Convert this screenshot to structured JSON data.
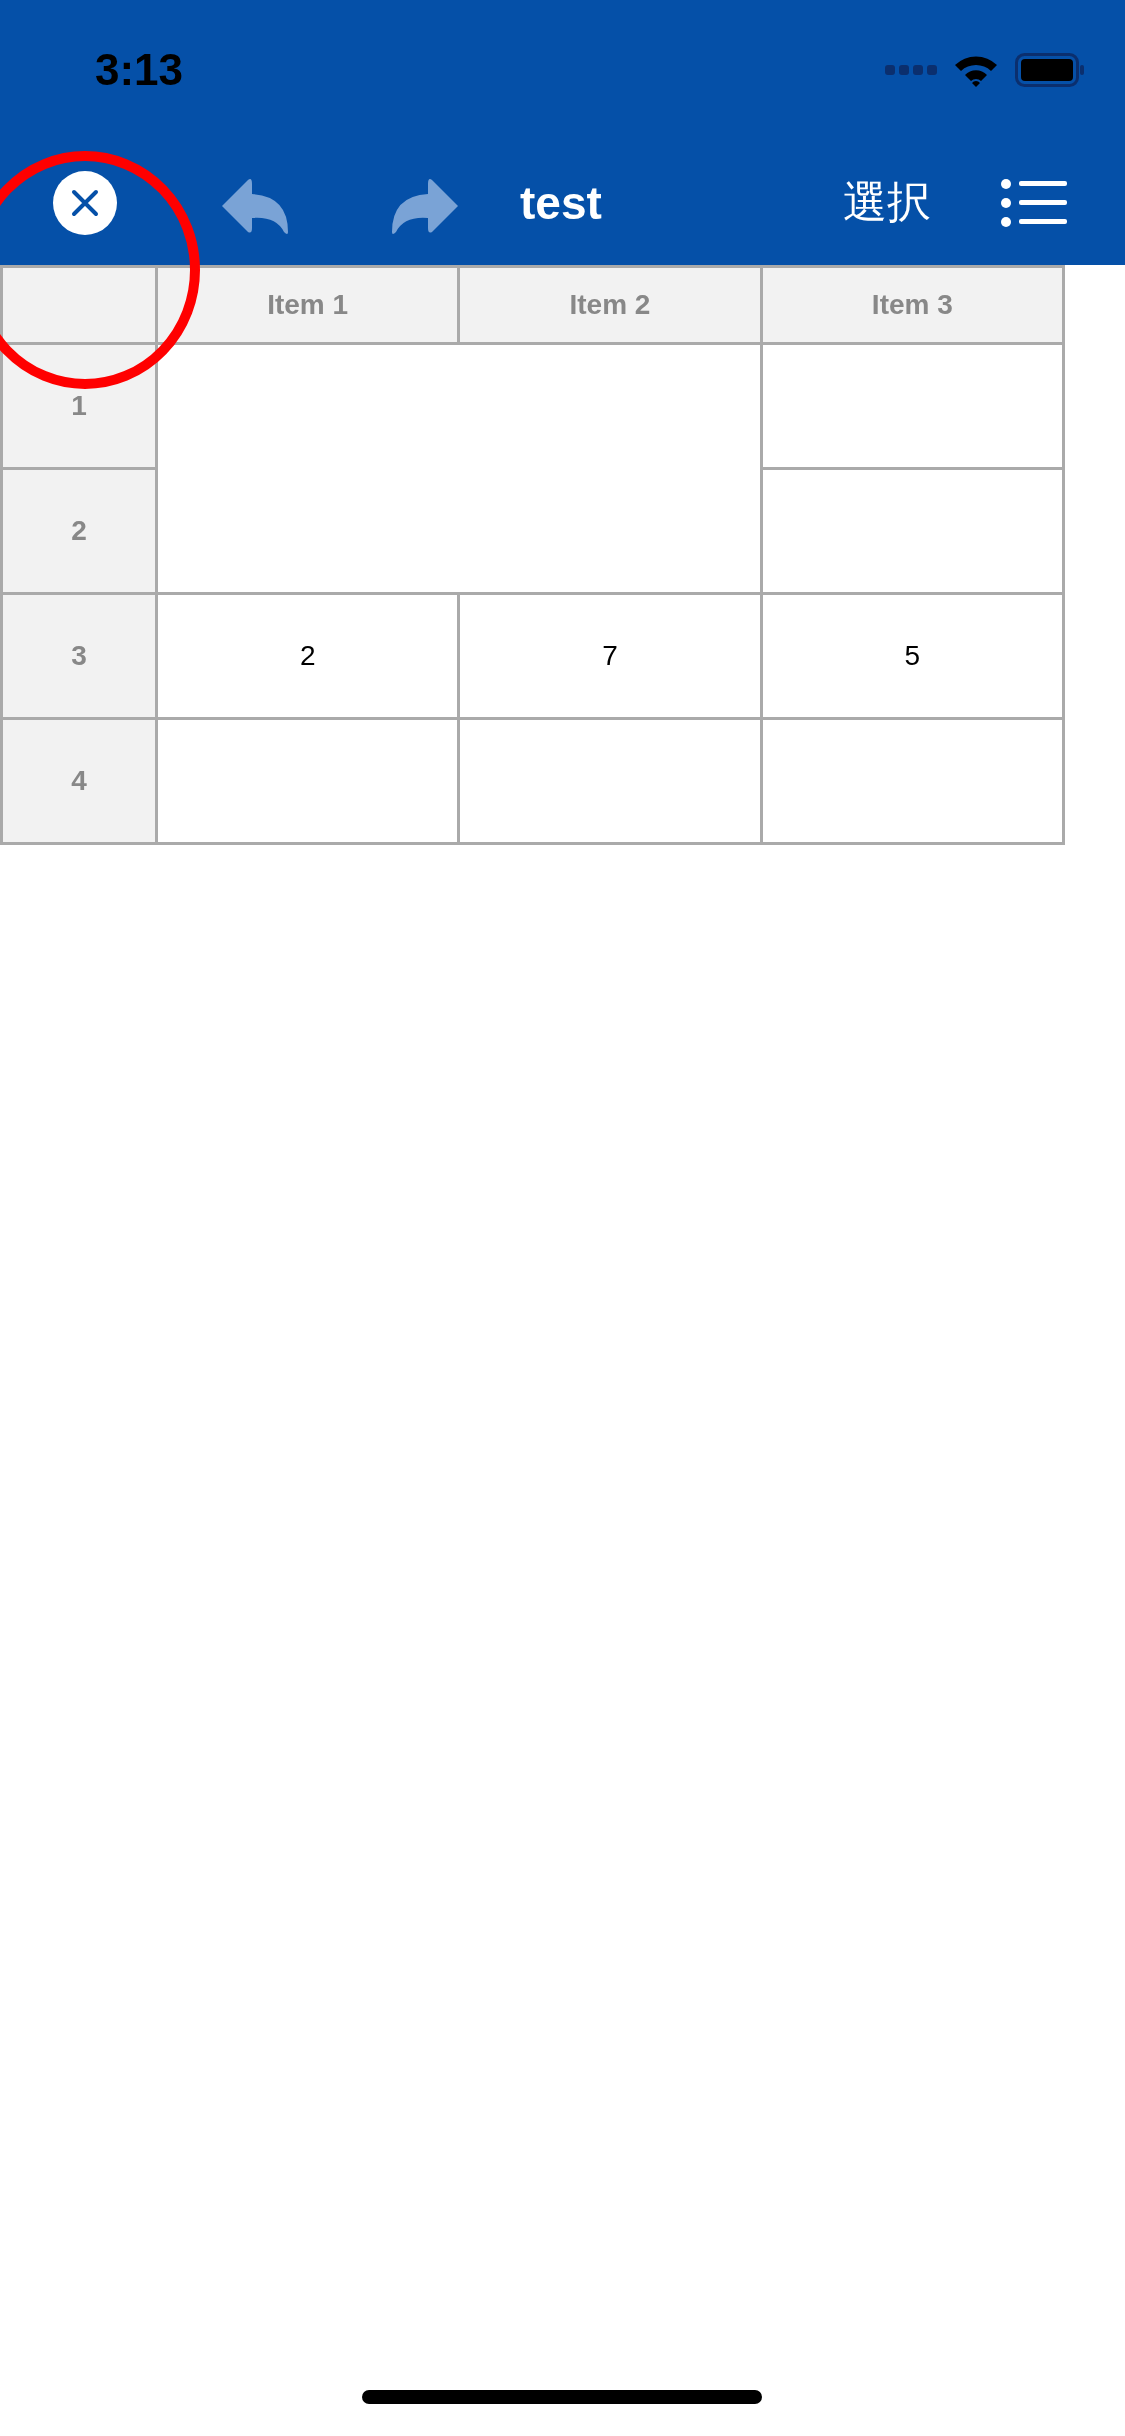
{
  "status_bar": {
    "time": "3:13"
  },
  "toolbar": {
    "title": "test",
    "select_label": "選択"
  },
  "table": {
    "columns": [
      "Item 1",
      "Item 2",
      "Item 3"
    ],
    "rows": [
      {
        "header": "1",
        "cells": [
          {
            "rowspan": 2,
            "colspan": 2
          },
          {}
        ]
      },
      {
        "header": "2",
        "cells": [
          {}
        ]
      },
      {
        "header": "3",
        "cells": [
          {
            "text": "2"
          },
          {
            "text": "7"
          },
          {
            "text": "5"
          }
        ]
      },
      {
        "header": "4",
        "cells": [
          {},
          {},
          {}
        ]
      }
    ]
  }
}
